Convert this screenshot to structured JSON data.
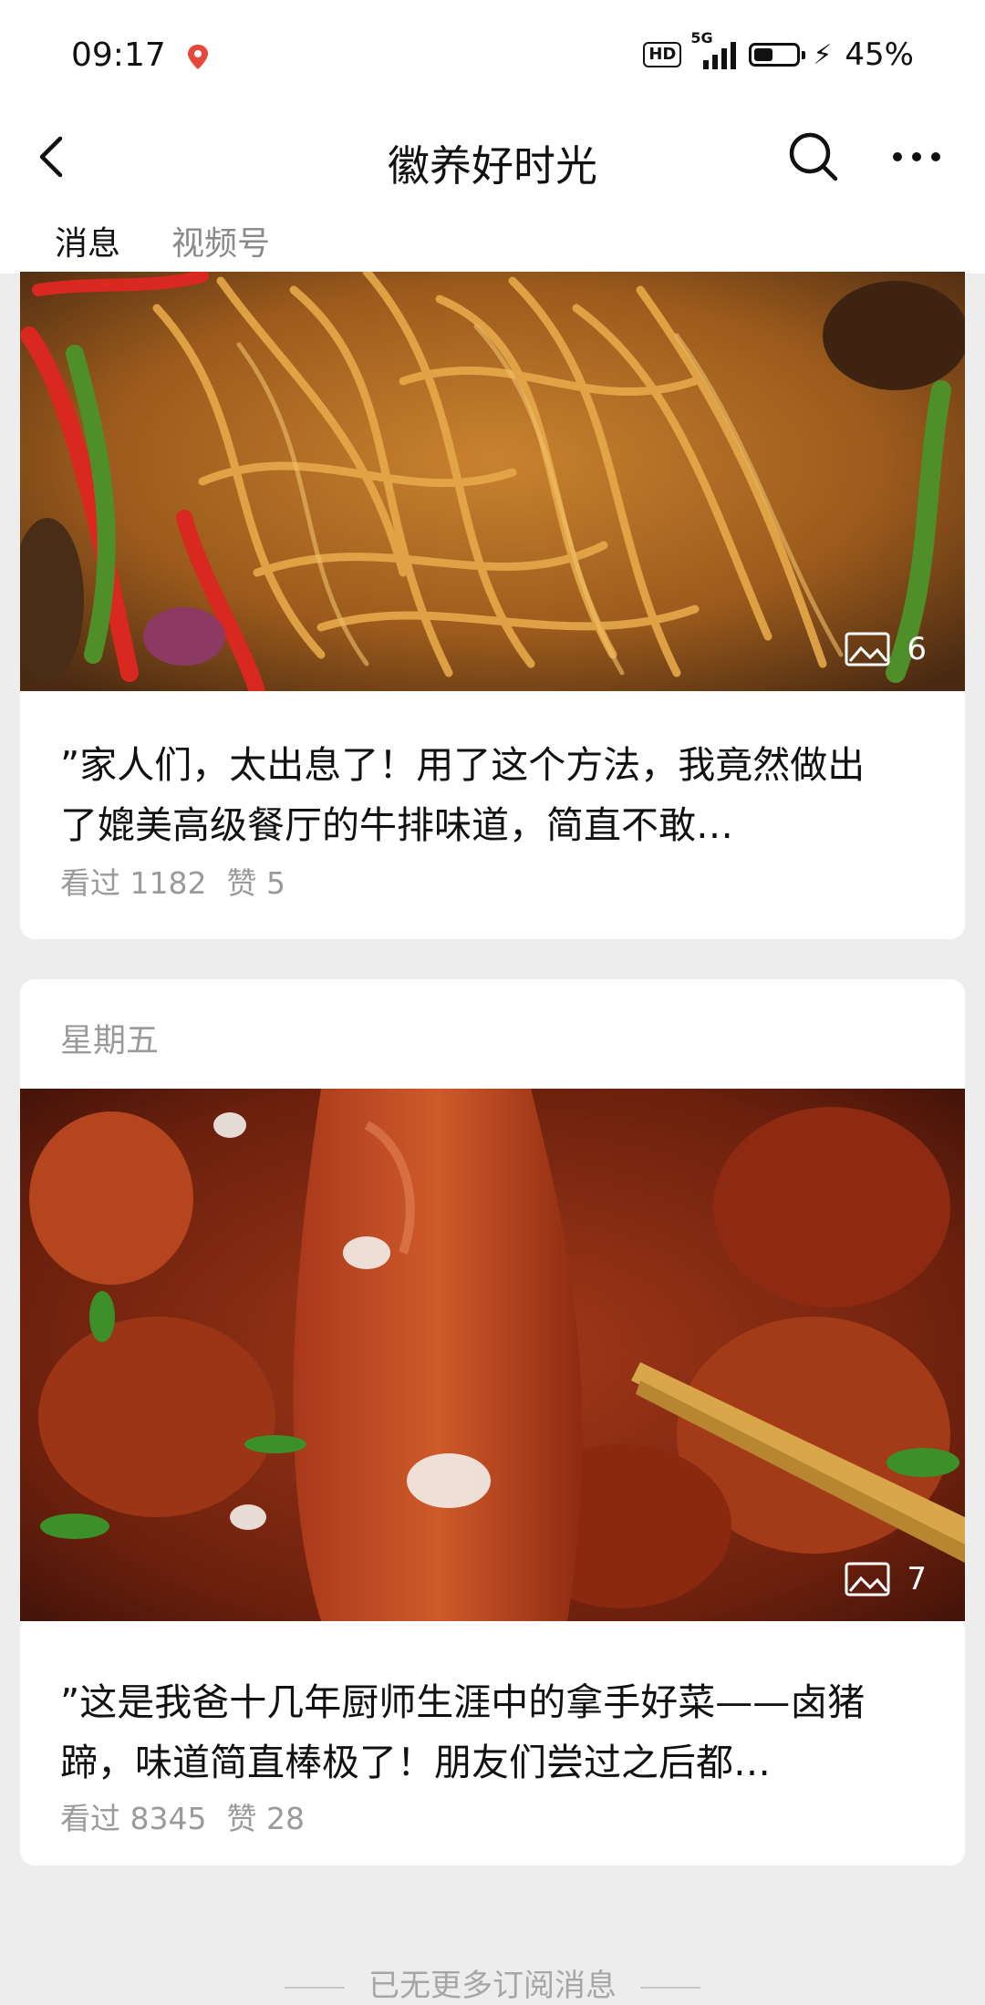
{
  "status_bar": {
    "time": "09:17",
    "hd": "HD",
    "network": "5G",
    "battery": "45%",
    "battery_level": 0.45
  },
  "nav": {
    "title": "徽养好时光",
    "back_icon": "back-arrow-icon",
    "search_icon": "search-icon",
    "more_icon": "more-icon"
  },
  "tabs": [
    {
      "label": "消息",
      "active": true
    },
    {
      "label": "视频号",
      "active": false
    }
  ],
  "articles": [
    {
      "date": "",
      "image_count": "6",
      "text": "”家人们，太出息了！用了这个方法，我竟然做出了媲美高级餐厅的牛排味道，简直不敢…",
      "views": "看过 1182",
      "likes": "赞 5"
    },
    {
      "date": "星期五",
      "image_count": "7",
      "text": "”这是我爸十几年厨师生涯中的拿手好菜——卤猪蹄，味道简直棒极了！朋友们尝过之后都…",
      "views": "看过 8345",
      "likes": "赞 28"
    }
  ],
  "footer": {
    "text": "已无更多订阅消息"
  },
  "colors": {
    "background": "#ededed",
    "card": "#ffffff",
    "secondary_text": "#9a9a9a"
  }
}
